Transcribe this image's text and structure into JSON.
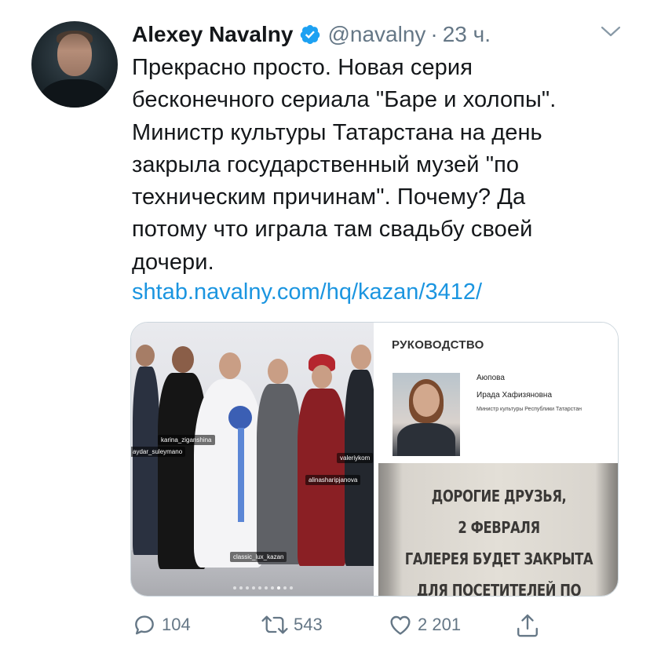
{
  "author": {
    "name": "Alexey Navalny",
    "handle": "@navalny",
    "time": "23 ч."
  },
  "tweet": {
    "lines": [
      "Прекрасно просто. Новая серия",
      "бесконечного сериала \"Баре и холопы\".",
      "Министр культуры Татарстана на день",
      "закрыла государственный музей \"по",
      "техническим причинам\". Почему? Да",
      "потому что играла там свадьбу своей",
      "дочери."
    ],
    "link": "shtab.navalny.com/hq/kazan/3412/"
  },
  "media": {
    "photo_tags": [
      "karina_ziganshina",
      "aydar_suleymano",
      "valeriykom",
      "alinasharipjanova",
      "classic_lux_kazan"
    ],
    "panel": {
      "heading": "РУКОВОДСТВО",
      "name_line1": "Аюпова",
      "name_line2": "Ирада Хафизяновна",
      "role": "Министр культуры Республики Татарстан"
    },
    "poster_lines": [
      "ДОРОГИЕ ДРУЗЬЯ,",
      "2 ФЕВРАЛЯ",
      "ГАЛЕРЕЯ БУДЕТ ЗАКРЫТА",
      "ДЛЯ ПОСЕТИТЕЛЕЙ ПО"
    ]
  },
  "actions": {
    "replies": "104",
    "retweets": "543",
    "likes": "2 201"
  },
  "colors": {
    "text": "#14171a",
    "secondary": "#657786",
    "link": "#1b95e0",
    "verified": "#1da1f2"
  }
}
